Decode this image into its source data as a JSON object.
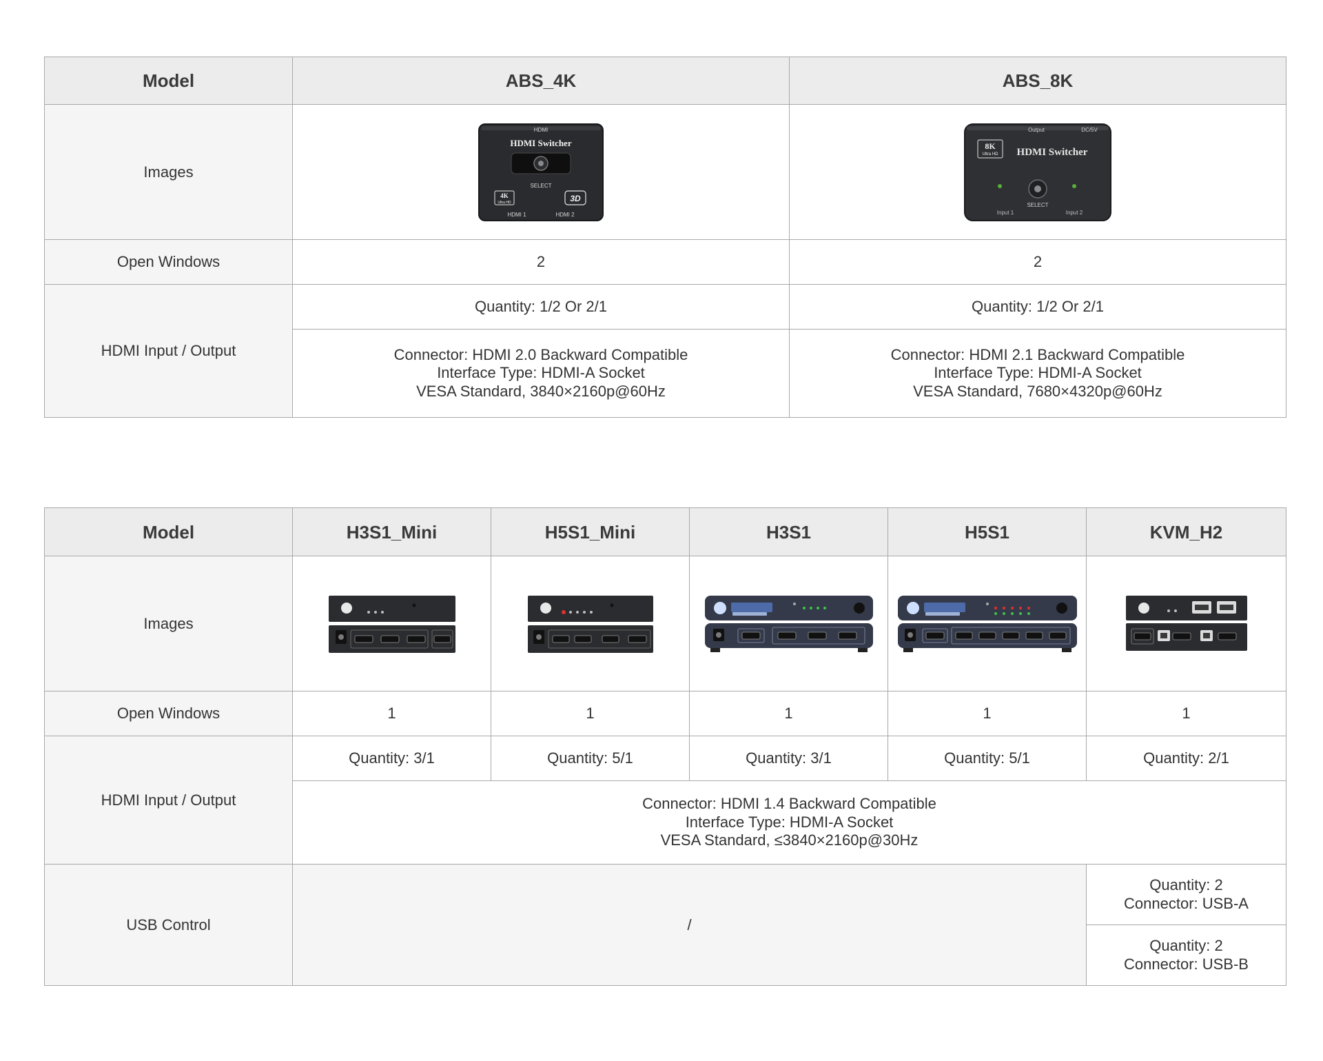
{
  "table1": {
    "model_label": "Model",
    "images_label": "Images",
    "open_windows_label": "Open Windows",
    "hdmi_label": "HDMI Input / Output",
    "columns": [
      {
        "model": "ABS_4K",
        "image": {
          "icon": "hdmi-switcher-4k-image",
          "texts": [
            "HDMI",
            "HDMI Switcher",
            "SELECT",
            "4K",
            "Ultra HD",
            "3D",
            "HDMI 1",
            "HDMI 2"
          ]
        },
        "open_windows": "2",
        "quantity": "Quantity: 1/2 Or 2/1",
        "connector_lines": [
          "Connector: HDMI 2.0 Backward Compatible",
          "Interface Type: HDMI-A Socket",
          "VESA Standard, 3840×2160p@60Hz"
        ]
      },
      {
        "model": "ABS_8K",
        "image": {
          "icon": "hdmi-switcher-8k-image",
          "texts": [
            "Output",
            "DC/5V",
            "8K",
            "Ultra HD",
            "HDMI Switcher",
            "SELECT",
            "Input 1",
            "Input 2"
          ]
        },
        "open_windows": "2",
        "quantity": "Quantity: 1/2 Or 2/1",
        "connector_lines": [
          "Connector: HDMI 2.1 Backward Compatible",
          "Interface Type: HDMI-A Socket",
          "VESA Standard, 7680×4320p@60Hz"
        ]
      }
    ]
  },
  "table2": {
    "model_label": "Model",
    "images_label": "Images",
    "open_windows_label": "Open Windows",
    "hdmi_label": "HDMI Input / Output",
    "usb_label": "USB Control",
    "columns": [
      {
        "model": "H3S1_Mini",
        "image_icon": "h3s1-mini-switch-image",
        "open_windows": "1",
        "quantity": "Quantity: 3/1"
      },
      {
        "model": "H5S1_Mini",
        "image_icon": "h5s1-mini-switch-image",
        "open_windows": "1",
        "quantity": "Quantity: 5/1"
      },
      {
        "model": "H3S1",
        "image_icon": "h3s1-switch-image",
        "open_windows": "1",
        "quantity": "Quantity: 3/1"
      },
      {
        "model": "H5S1",
        "image_icon": "h5s1-switch-image",
        "open_windows": "1",
        "quantity": "Quantity: 5/1"
      },
      {
        "model": "KVM_H2",
        "image_icon": "kvm-h2-switch-image",
        "open_windows": "1",
        "quantity": "Quantity: 2/1"
      }
    ],
    "connector_lines": [
      "Connector: HDMI 1.4 Backward Compatible",
      "Interface Type: HDMI-A Socket",
      "VESA Standard, ≤3840×2160p@30Hz"
    ],
    "usb_none": "/",
    "usb_a_lines": [
      "Quantity: 2",
      "Connector: USB-A"
    ],
    "usb_b_lines": [
      "Quantity: 2",
      "Connector: USB-B"
    ]
  },
  "colors": {
    "header_bg": "#ececec",
    "label_bg": "#f5f5f5",
    "border": "#a8a8a8",
    "text": "#333333"
  }
}
